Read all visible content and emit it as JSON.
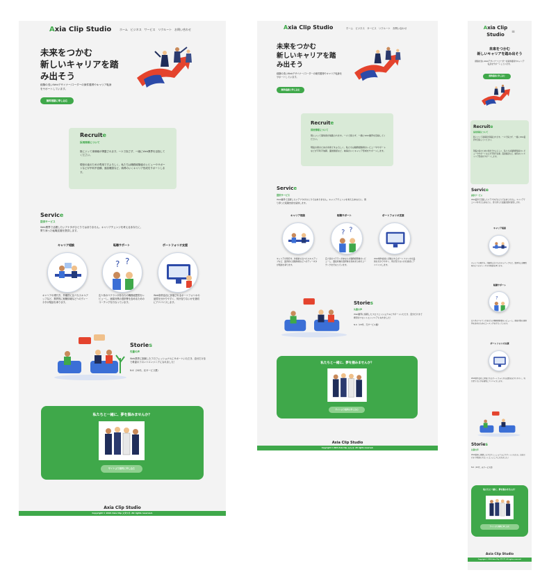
{
  "site": {
    "logo_first": "A",
    "logo_rest": "xia Clip Studio",
    "logo_mobile_line1": "Axia Clip",
    "logo_mobile_line2": "Studio",
    "nav": [
      "ホーム",
      "ビジネス",
      "サービス",
      "リクルート",
      "お問い合わせ"
    ],
    "hamburger": "≡"
  },
  "hero": {
    "title_line1": "未来をつかむ",
    "title_line2": "新しいキャリアを踏",
    "title_line3": "み出そう",
    "title_line2_tablet": "新しいキャリアを踏",
    "title_line3_tablet": "み出そう",
    "title_mobile_line1": "未来をつかむ",
    "title_mobile_line2": "新しいキャリアを踏み出そう",
    "desc": "経験の浅いWebデザイナー/コーダーの案件獲得やキャリア転身をサポートしています。",
    "cta": "無料相談に申し込む"
  },
  "recruit": {
    "title_main": "Recruit",
    "title_accent": "e",
    "subtitle": "採用情報について",
    "p1": "既にジッて事情報が掲載されます。一人で探さず、一緒にWeb業界を目指してください。",
    "p2": "現役の者のための専用ですよろしく、私たちは職務経験者のレビューやサポートなどが不利不信頼、面談確認など、納得のいくキャリア形成をサポートします。"
  },
  "service": {
    "title_main": "Servic",
    "title_accent": "e",
    "subtitle": "提供サービス",
    "desc": "Web業界で活躍したいアナタがひとりではありません。キャリアチェンジを考えるあなたに、寄り添った転職支援を提供します。",
    "items": [
      {
        "title": "キャリア相談",
        "desc": "キャリアの現行方、外観的に比べたスキルアップなど、業界的に就職情報などへのディーネタが相談を承ります。"
      },
      {
        "title": "転職サポート",
        "desc": "広人系のベテランがあなたの職務経歴書をレビューし、面接対策の選択等を含めまためのコーチングを行なっています。"
      },
      {
        "title": "ポートフォリオ支援",
        "desc": "Web制作会社に評価されるポートフォリオの品質を分かりやすく、何が足りないかを適切にアドバイスします。"
      }
    ]
  },
  "stories": {
    "title_main": "Storie",
    "title_accent": "s",
    "subtitle": "先輩の声",
    "desc": "Web業界に挑戦したフロフェッショナルにサポートいただき、自分だけまで希望のフロントエンジニアになれました！",
    "sign": "N.K（20代、元サービス業）"
  },
  "join": {
    "title": "私たちと一緒に、夢を掴みませんか？",
    "button": "サイトより無料に申し込む"
  },
  "footer": {
    "logo": "Axia Clip Studio",
    "copyright": "Copyright © 2024 Axia Clip スタジオ. All rights reserved."
  },
  "colors": {
    "accent": "#3fa84a",
    "page_bg": "#f3f3f3",
    "card_bg": "#d9ead7",
    "hero_arrow": "#e4432d"
  }
}
